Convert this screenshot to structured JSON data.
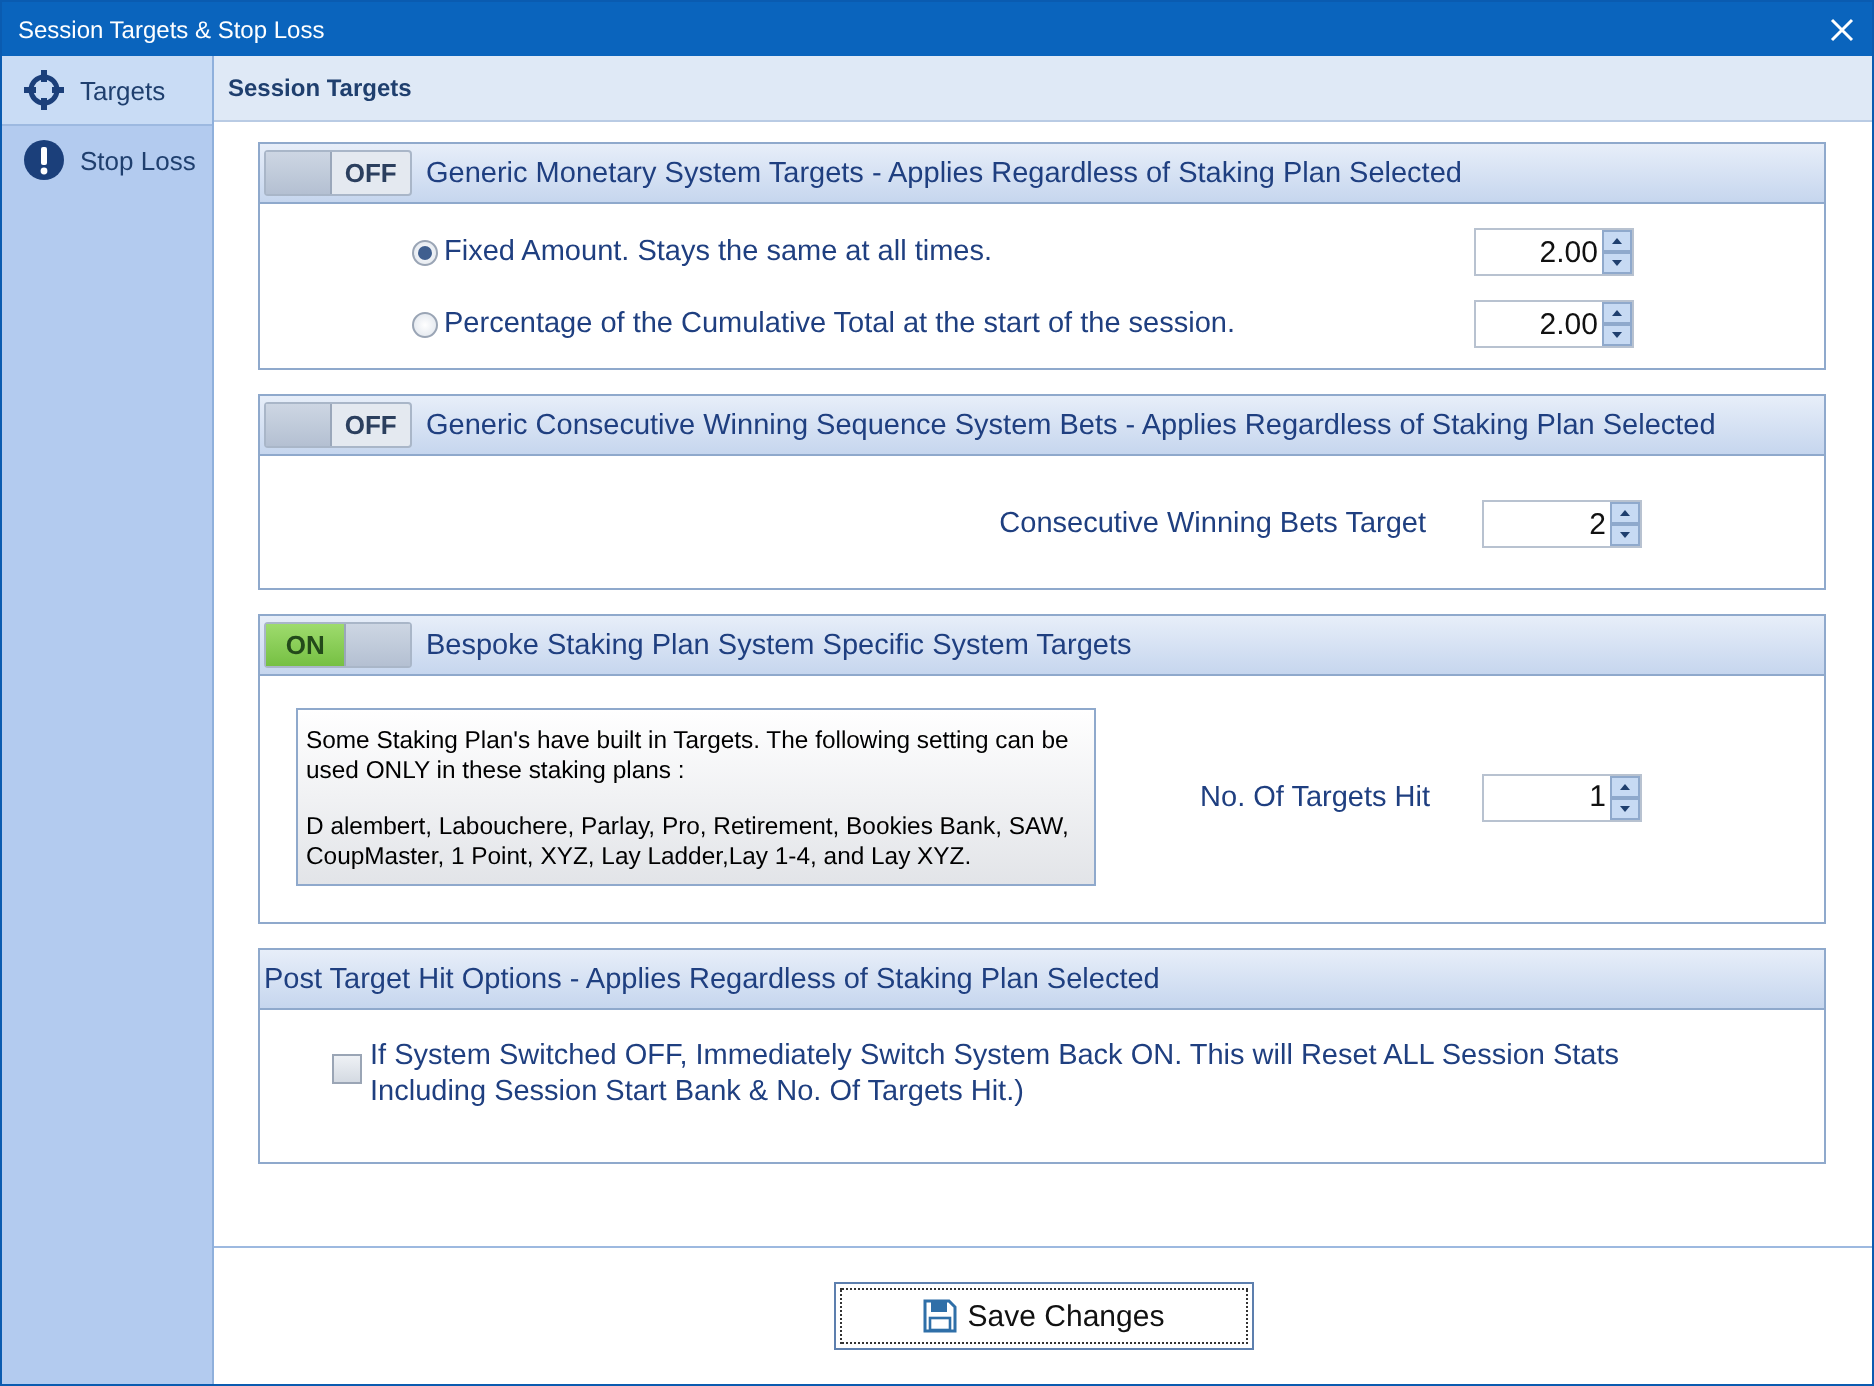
{
  "window": {
    "title": "Session Targets & Stop Loss"
  },
  "sidebar": {
    "items": [
      {
        "label": "Targets",
        "kind": "target",
        "selected": true
      },
      {
        "label": "Stop Loss",
        "kind": "alert",
        "selected": false
      }
    ]
  },
  "header": "Session Targets",
  "groups": [
    {
      "kind": "radio",
      "toggle": {
        "on": false,
        "label": "OFF"
      },
      "title": "Generic Monetary System Targets - Applies Regardless of Staking Plan Selected",
      "options": [
        {
          "label": "Fixed Amount. Stays the same at all times.",
          "selected": true,
          "value": "2.00"
        },
        {
          "label": "Percentage of the Cumulative Total at the start of the session.",
          "selected": false,
          "value": "2.00"
        }
      ]
    },
    {
      "kind": "field",
      "toggle": {
        "on": false,
        "label": "OFF"
      },
      "title": "Generic Consecutive Winning Sequence System Bets - Applies Regardless of Staking Plan Selected",
      "field": {
        "label": "Consecutive Winning Bets Target",
        "value": "2"
      }
    },
    {
      "kind": "info",
      "toggle": {
        "on": true,
        "label": "ON"
      },
      "title": "Bespoke Staking Plan System Specific System Targets",
      "note": [
        "Some Staking Plan's have built in Targets. The following setting can be used ONLY in these staking plans :",
        "D alembert, Labouchere, Parlay, Pro, Retirement, Bookies Bank, SAW, CoupMaster, 1 Point, XYZ, Lay Ladder,Lay 1-4, and Lay XYZ."
      ],
      "field": {
        "label": "No. Of Targets Hit",
        "value": "1"
      }
    },
    {
      "kind": "checkbox",
      "title": "Post Target Hit Options - Applies Regardless of Staking Plan Selected",
      "checkbox": {
        "lines": [
          "If System Switched OFF, Immediately Switch System Back ON. This will Reset ALL Session Stats",
          "Including Session Start Bank & No. Of Targets Hit.)"
        ],
        "checked": false
      }
    }
  ],
  "buttons": [
    {
      "label": "Save Changes"
    }
  ]
}
